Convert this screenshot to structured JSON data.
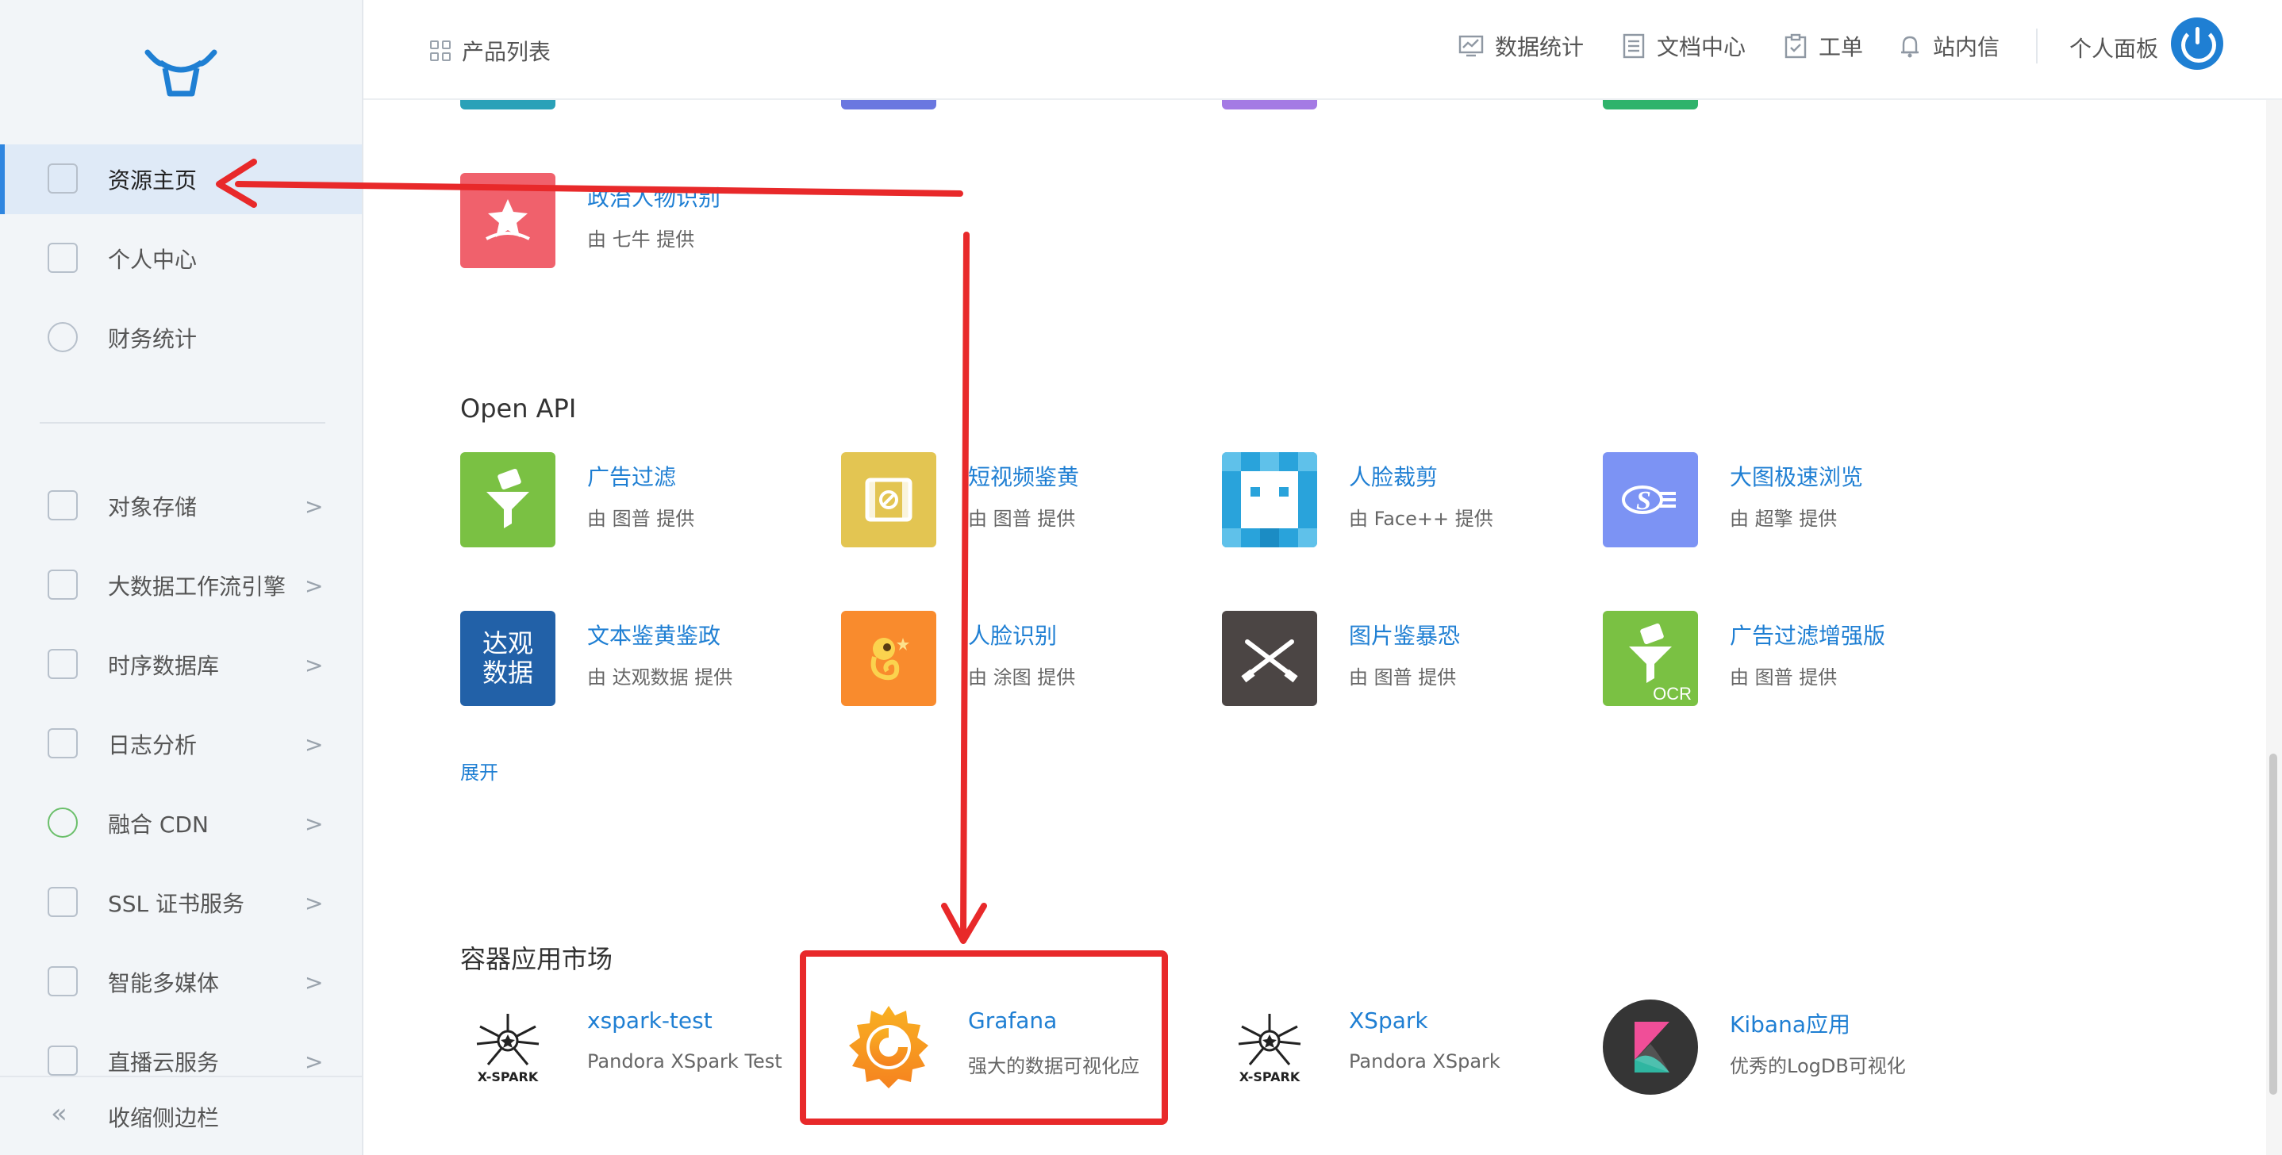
{
  "sidebar": {
    "items": [
      {
        "label": "资源主页",
        "active": true
      },
      {
        "label": "个人中心"
      },
      {
        "label": "财务统计"
      },
      {
        "label": "对象存储",
        "chevron": ">"
      },
      {
        "label": "大数据工作流引擎",
        "chevron": ">"
      },
      {
        "label": "时序数据库",
        "chevron": ">"
      },
      {
        "label": "日志分析",
        "chevron": ">"
      },
      {
        "label": "融合 CDN",
        "chevron": ">"
      },
      {
        "label": "SSL 证书服务",
        "chevron": ">"
      },
      {
        "label": "智能多媒体",
        "chevron": ">"
      },
      {
        "label": "直播云服务",
        "chevron": ">"
      }
    ],
    "collapse_label": "收缩侧边栏",
    "collapse_icon": "«"
  },
  "topbar": {
    "product_list": "产品列表",
    "items": [
      "数据统计",
      "文档中心",
      "工单",
      "站内信"
    ],
    "panel": "个人面板"
  },
  "content": {
    "political": {
      "name": "政治人物识别",
      "sub": "由 七牛 提供"
    },
    "openapi": {
      "title": "Open API",
      "cards": [
        {
          "name": "广告过滤",
          "sub": "由 图普 提供"
        },
        {
          "name": "短视频鉴黄",
          "sub": "由 图普 提供"
        },
        {
          "name": "人脸裁剪",
          "sub": "由 Face++ 提供"
        },
        {
          "name": "大图极速浏览",
          "sub": "由 超擎 提供"
        },
        {
          "name": "文本鉴黄鉴政",
          "sub": "由 达观数据 提供"
        },
        {
          "name": "人脸识别",
          "sub": "由 涂图 提供"
        },
        {
          "name": "图片鉴暴恐",
          "sub": "由 图普 提供"
        },
        {
          "name": "广告过滤增强版",
          "sub": "由 图普 提供"
        }
      ],
      "expand": "展开",
      "tile_text_daguan": [
        "达观",
        "数据"
      ],
      "tile_text_ocr": "OCR"
    },
    "market": {
      "title": "容器应用市场",
      "cards": [
        {
          "name": "xspark-test",
          "sub": "Pandora XSpark Test"
        },
        {
          "name": "Grafana",
          "sub": "强大的数据可视化应"
        },
        {
          "name": "XSpark",
          "sub": "Pandora XSpark"
        },
        {
          "name": "Kibana应用",
          "sub": "优秀的LogDB可视化"
        }
      ],
      "xspark_logo_text": "X-SPARK"
    }
  },
  "colors": {
    "accent": "#1f7fd3",
    "annotation": "#e8292a",
    "sidebar_bg": "#f2f5f8",
    "active_bg": "#dfeaf7"
  },
  "icons": [
    "logo-icon",
    "grid-icon",
    "chart-icon",
    "doc-icon",
    "clipboard-icon",
    "bell-icon",
    "power-icon",
    "chevron-right-icon",
    "collapse-icon"
  ]
}
